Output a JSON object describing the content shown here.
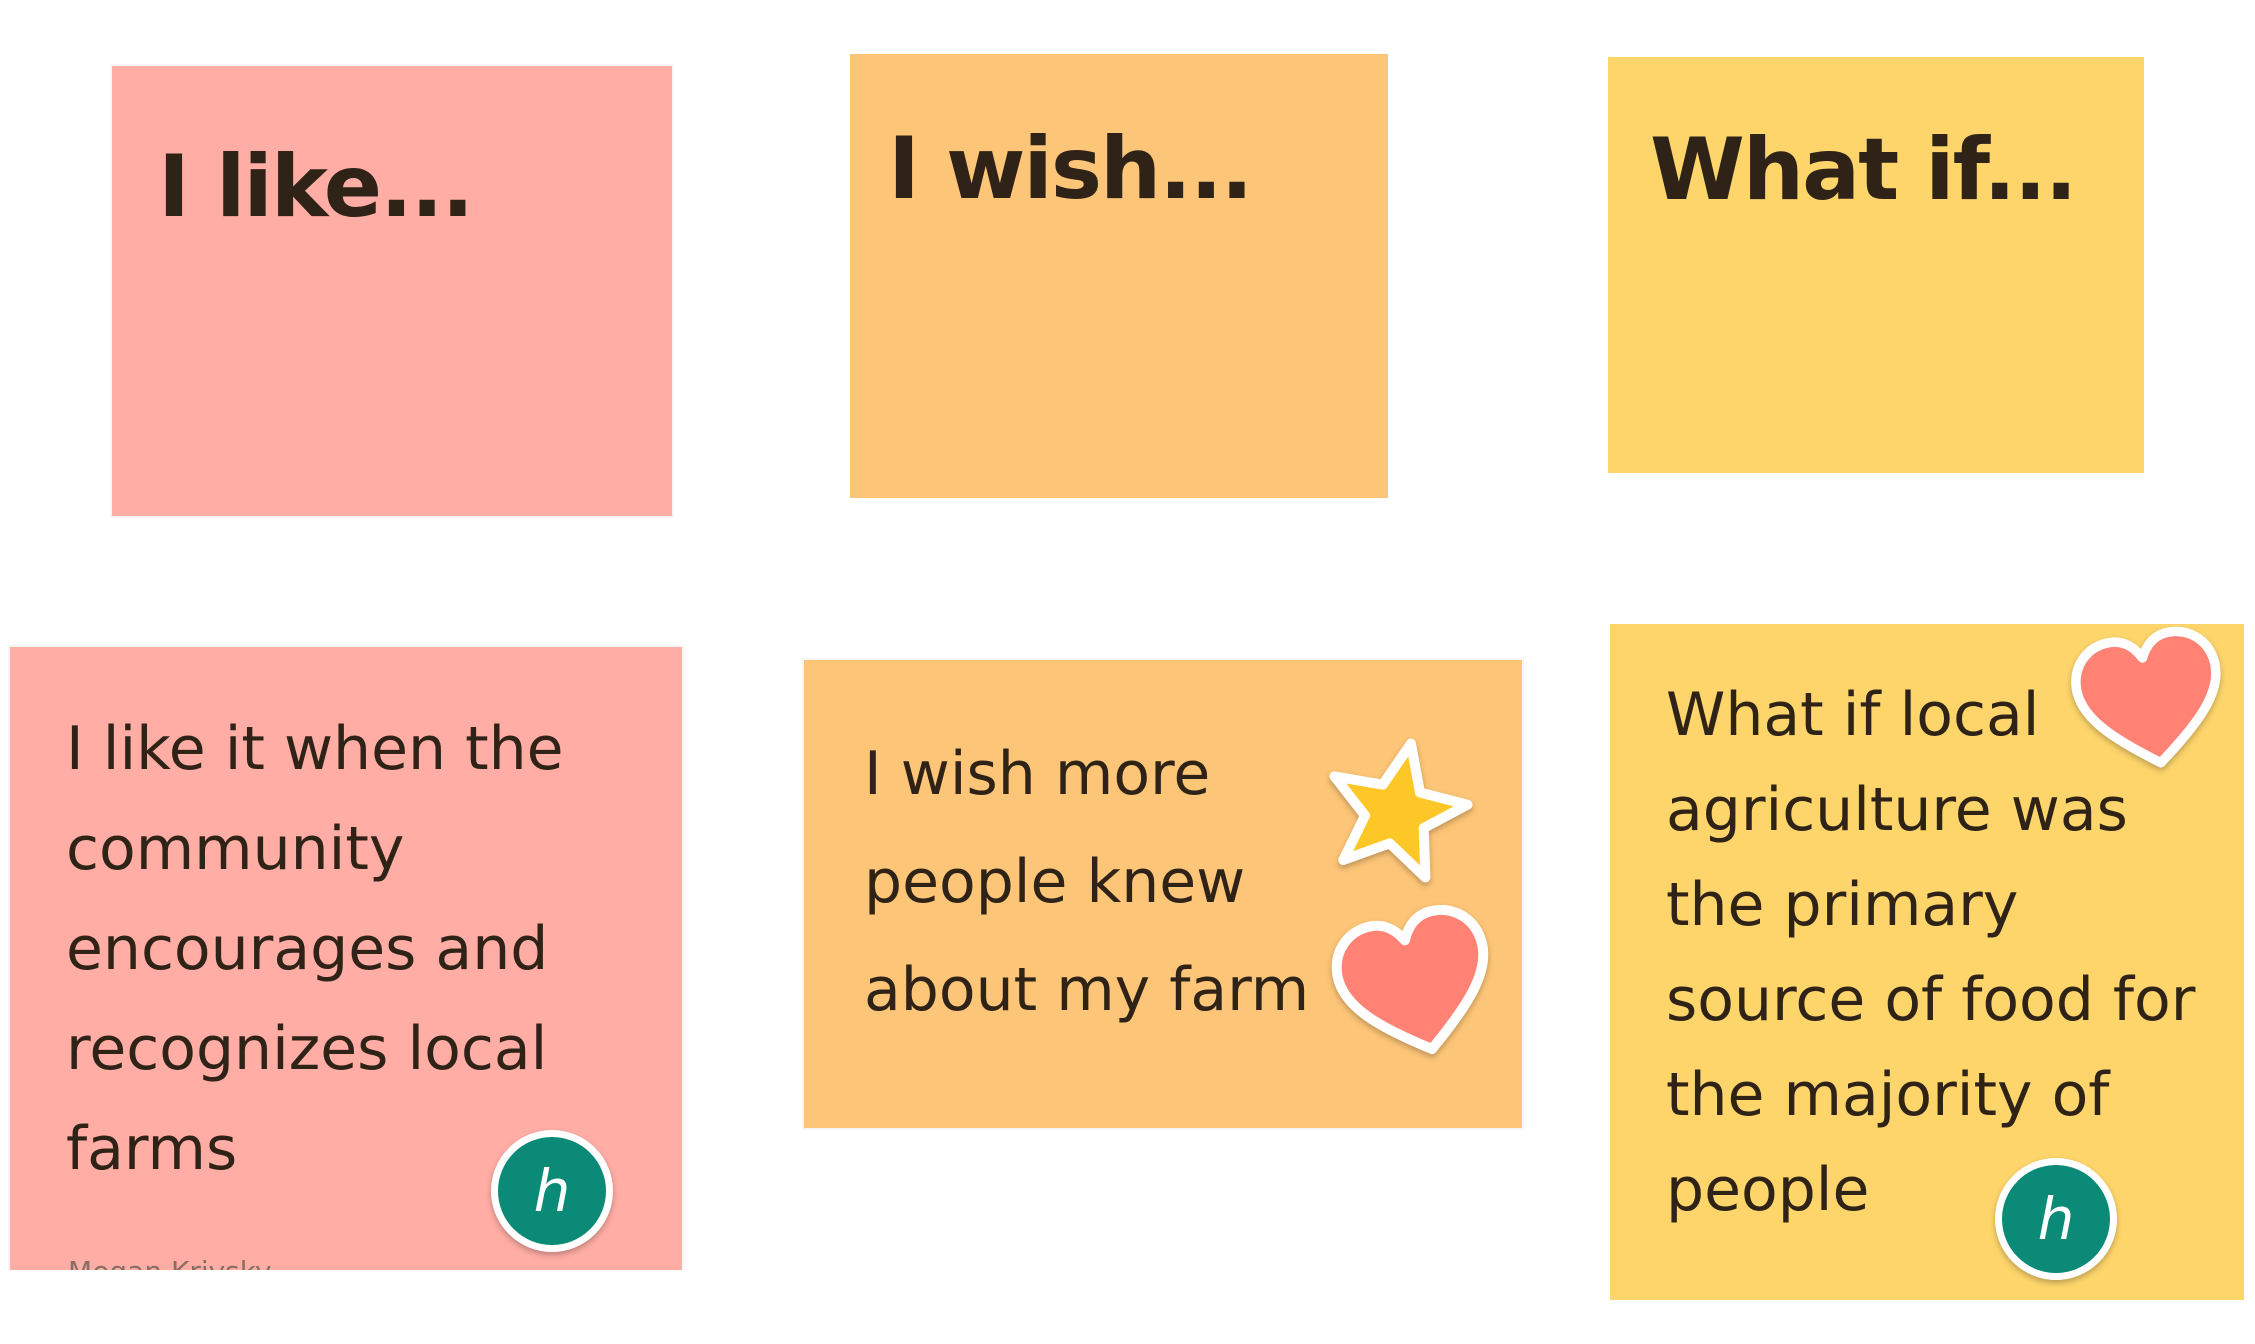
{
  "colors": {
    "like": "#ffada5",
    "wish": "#fdc577",
    "whatif": "#fdd56b",
    "avatar": "#0b8a77",
    "star": "#fdc727",
    "heart": "#ff8275"
  },
  "headers": {
    "like": "I like...",
    "wish": "I wish...",
    "whatif": "What if..."
  },
  "cards": {
    "like": {
      "text": "I like it when the\ncommunity\nencourages and\nrecognizes local\nfarms",
      "author": "Megan Krivsky",
      "avatar_initial": "h"
    },
    "wish": {
      "text": "I wish more\npeople knew\nabout my farm",
      "stickers": [
        "star-icon",
        "heart-icon"
      ]
    },
    "whatif": {
      "text": "What if local\nagriculture was\nthe primary\nsource of food for\nthe majority of\npeople",
      "avatar_initial": "h",
      "stickers": [
        "heart-icon"
      ]
    }
  }
}
